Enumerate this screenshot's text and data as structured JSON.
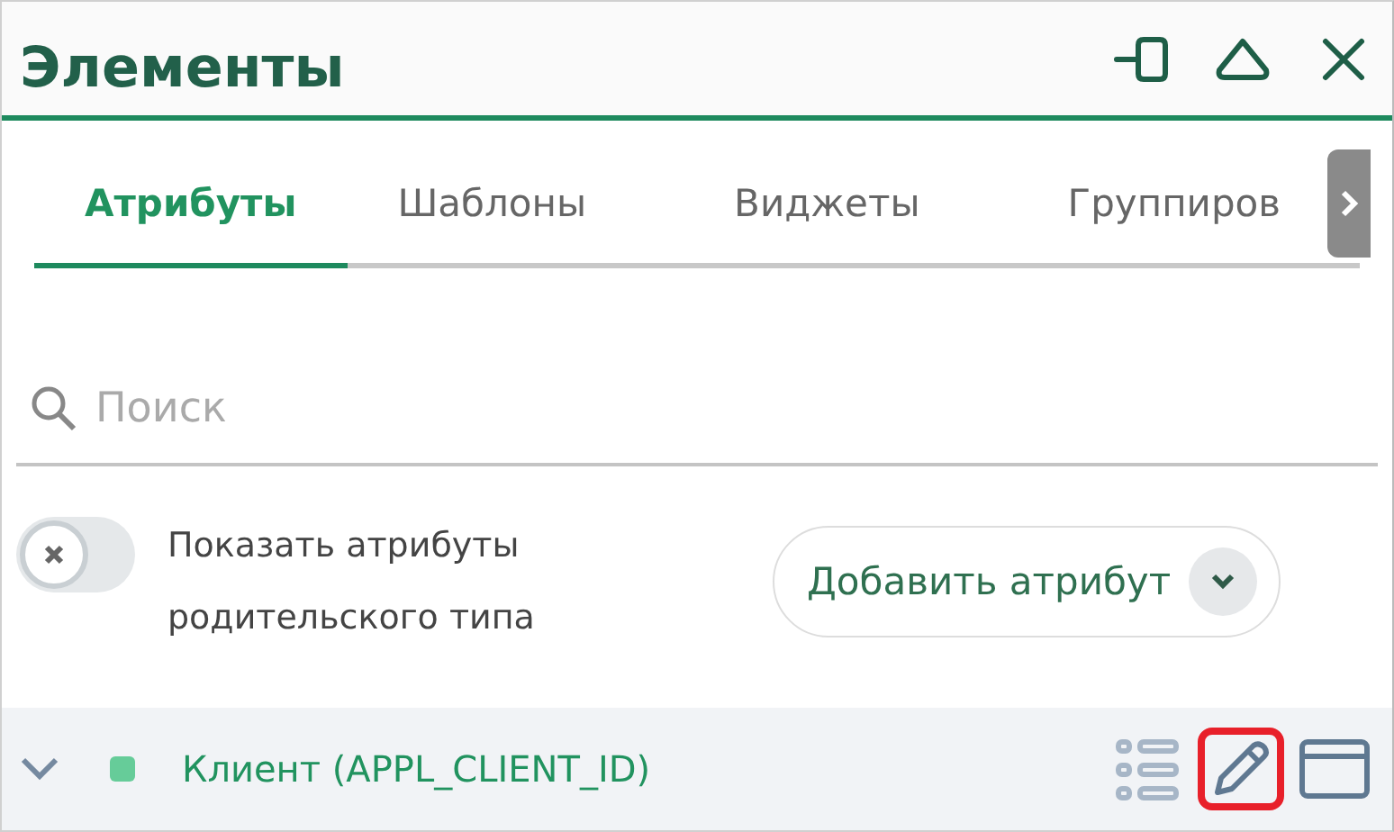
{
  "panel": {
    "title": "Элементы"
  },
  "tabs": [
    {
      "label": "Атрибуты",
      "selected": true
    },
    {
      "label": "Шаблоны",
      "selected": false
    },
    {
      "label": "Виджеты",
      "selected": false
    },
    {
      "label": "Группиров",
      "selected": false
    }
  ],
  "search": {
    "placeholder": "Поиск"
  },
  "parent_toggle": {
    "on": false,
    "label": "Показать атрибуты родительского типа"
  },
  "add_button": {
    "label": "Добавить атрибут"
  },
  "attributes": [
    {
      "label": "Клиент (APPL_CLIENT_ID)",
      "expanded": false,
      "color": "#66cc99",
      "actions": [
        {
          "kind": "list",
          "highlighted": false
        },
        {
          "kind": "edit",
          "highlighted": true
        },
        {
          "kind": "window",
          "highlighted": false
        }
      ]
    }
  ]
}
